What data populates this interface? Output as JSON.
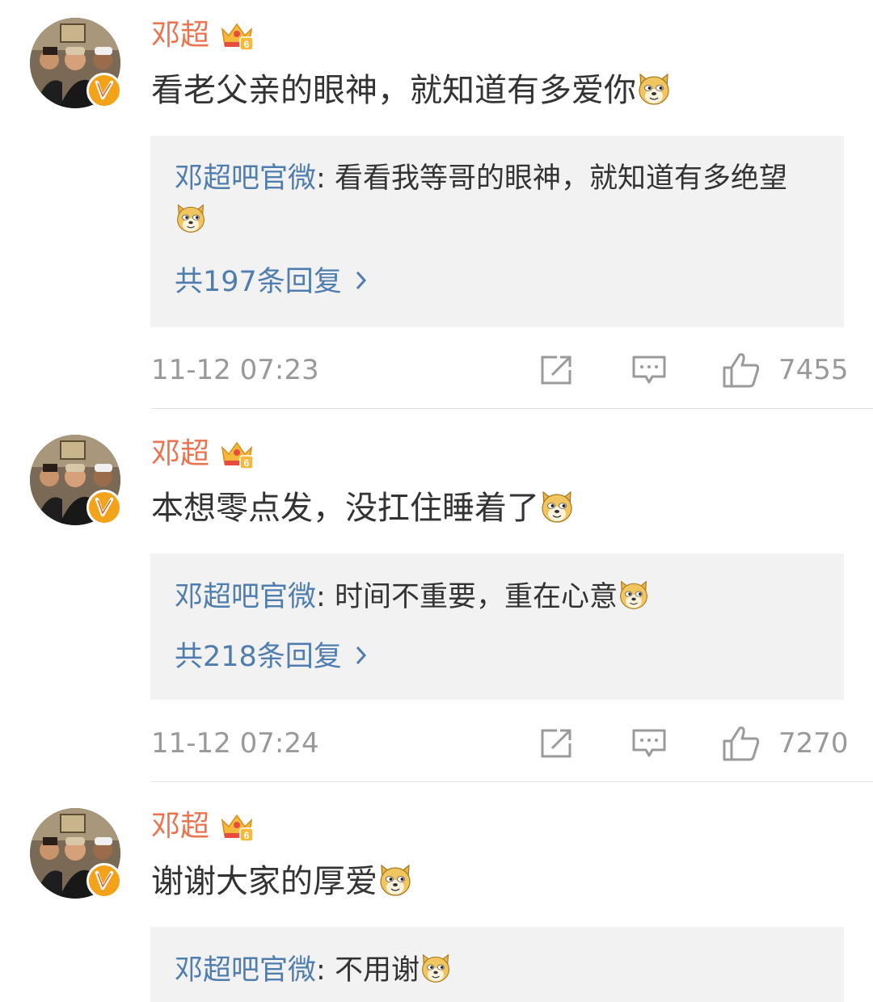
{
  "comments": [
    {
      "author": "邓超",
      "text": "看老父亲的眼神，就知道有多爱你",
      "reply": {
        "author": "邓超吧官微",
        "separator": ": ",
        "text": "看看我等哥的眼神，就知道有多绝望"
      },
      "reply_count": "共197条回复",
      "time": "11-12 07:23",
      "likes": "7455"
    },
    {
      "author": "邓超",
      "text": "本想零点发，没扛住睡着了",
      "reply": {
        "author": "邓超吧官微",
        "separator": ": ",
        "text": "时间不重要，重在心意"
      },
      "reply_count": "共218条回复",
      "time": "11-12 07:24",
      "likes": "7270"
    },
    {
      "author": "邓超",
      "text": "谢谢大家的厚爱",
      "reply": {
        "author": "邓超吧官微",
        "separator": ": ",
        "text": "不用谢"
      }
    }
  ],
  "icons": {
    "badge": "verified-v-icon",
    "crown": "vip-crown-icon",
    "emoji": "doge-emoji-icon",
    "repost": "repost-icon",
    "comment": "comment-icon",
    "like": "like-icon",
    "chevron": "chevron-right-icon"
  },
  "colors": {
    "name": "#eb7350",
    "link": "#507daf",
    "meta": "#999999",
    "reply_bg": "#f2f2f2",
    "badge": "#f3a31a"
  }
}
